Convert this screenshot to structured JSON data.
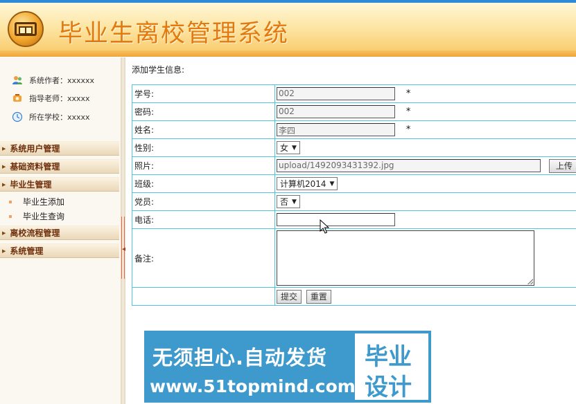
{
  "header": {
    "title": "毕业生离校管理系统"
  },
  "sidebar": {
    "info": [
      {
        "label": "系统作者：xxxxxx",
        "icon": "users-icon"
      },
      {
        "label": "指导老师：xxxxx",
        "icon": "teacher-icon"
      },
      {
        "label": "所在学校：xxxxx",
        "icon": "school-icon"
      }
    ],
    "menu": {
      "system_users": "系统用户管理",
      "basic_data": "基础资料管理",
      "graduate_mgmt": "毕业生管理",
      "graduate_add": "毕业生添加",
      "graduate_query": "毕业生查询",
      "leave_flow": "离校流程管理",
      "system_mgmt": "系统管理"
    }
  },
  "main": {
    "title": "添加学生信息:",
    "form": {
      "student_no": {
        "label": "学号:",
        "value": "002",
        "required": "*"
      },
      "password": {
        "label": "密码:",
        "value": "002",
        "required": "*"
      },
      "name": {
        "label": "姓名:",
        "value": "李四",
        "required": "*"
      },
      "gender": {
        "label": "性别:",
        "value": "女"
      },
      "photo": {
        "label": "照片:",
        "value": "upload/1492093431392.jpg",
        "upload_label": "上传"
      },
      "class": {
        "label": "班级:",
        "value": "计算机2014"
      },
      "party_member": {
        "label": "党员:",
        "value": "否"
      },
      "phone": {
        "label": "电话:",
        "value": ""
      },
      "remark": {
        "label": "备注:",
        "value": ""
      },
      "submit_label": "提交",
      "reset_label": "重置"
    }
  },
  "banner": {
    "line1": "无须担心.自动发货",
    "line2": "www.51topmind.com",
    "right_line1": "毕业",
    "right_line2": "设计"
  }
}
